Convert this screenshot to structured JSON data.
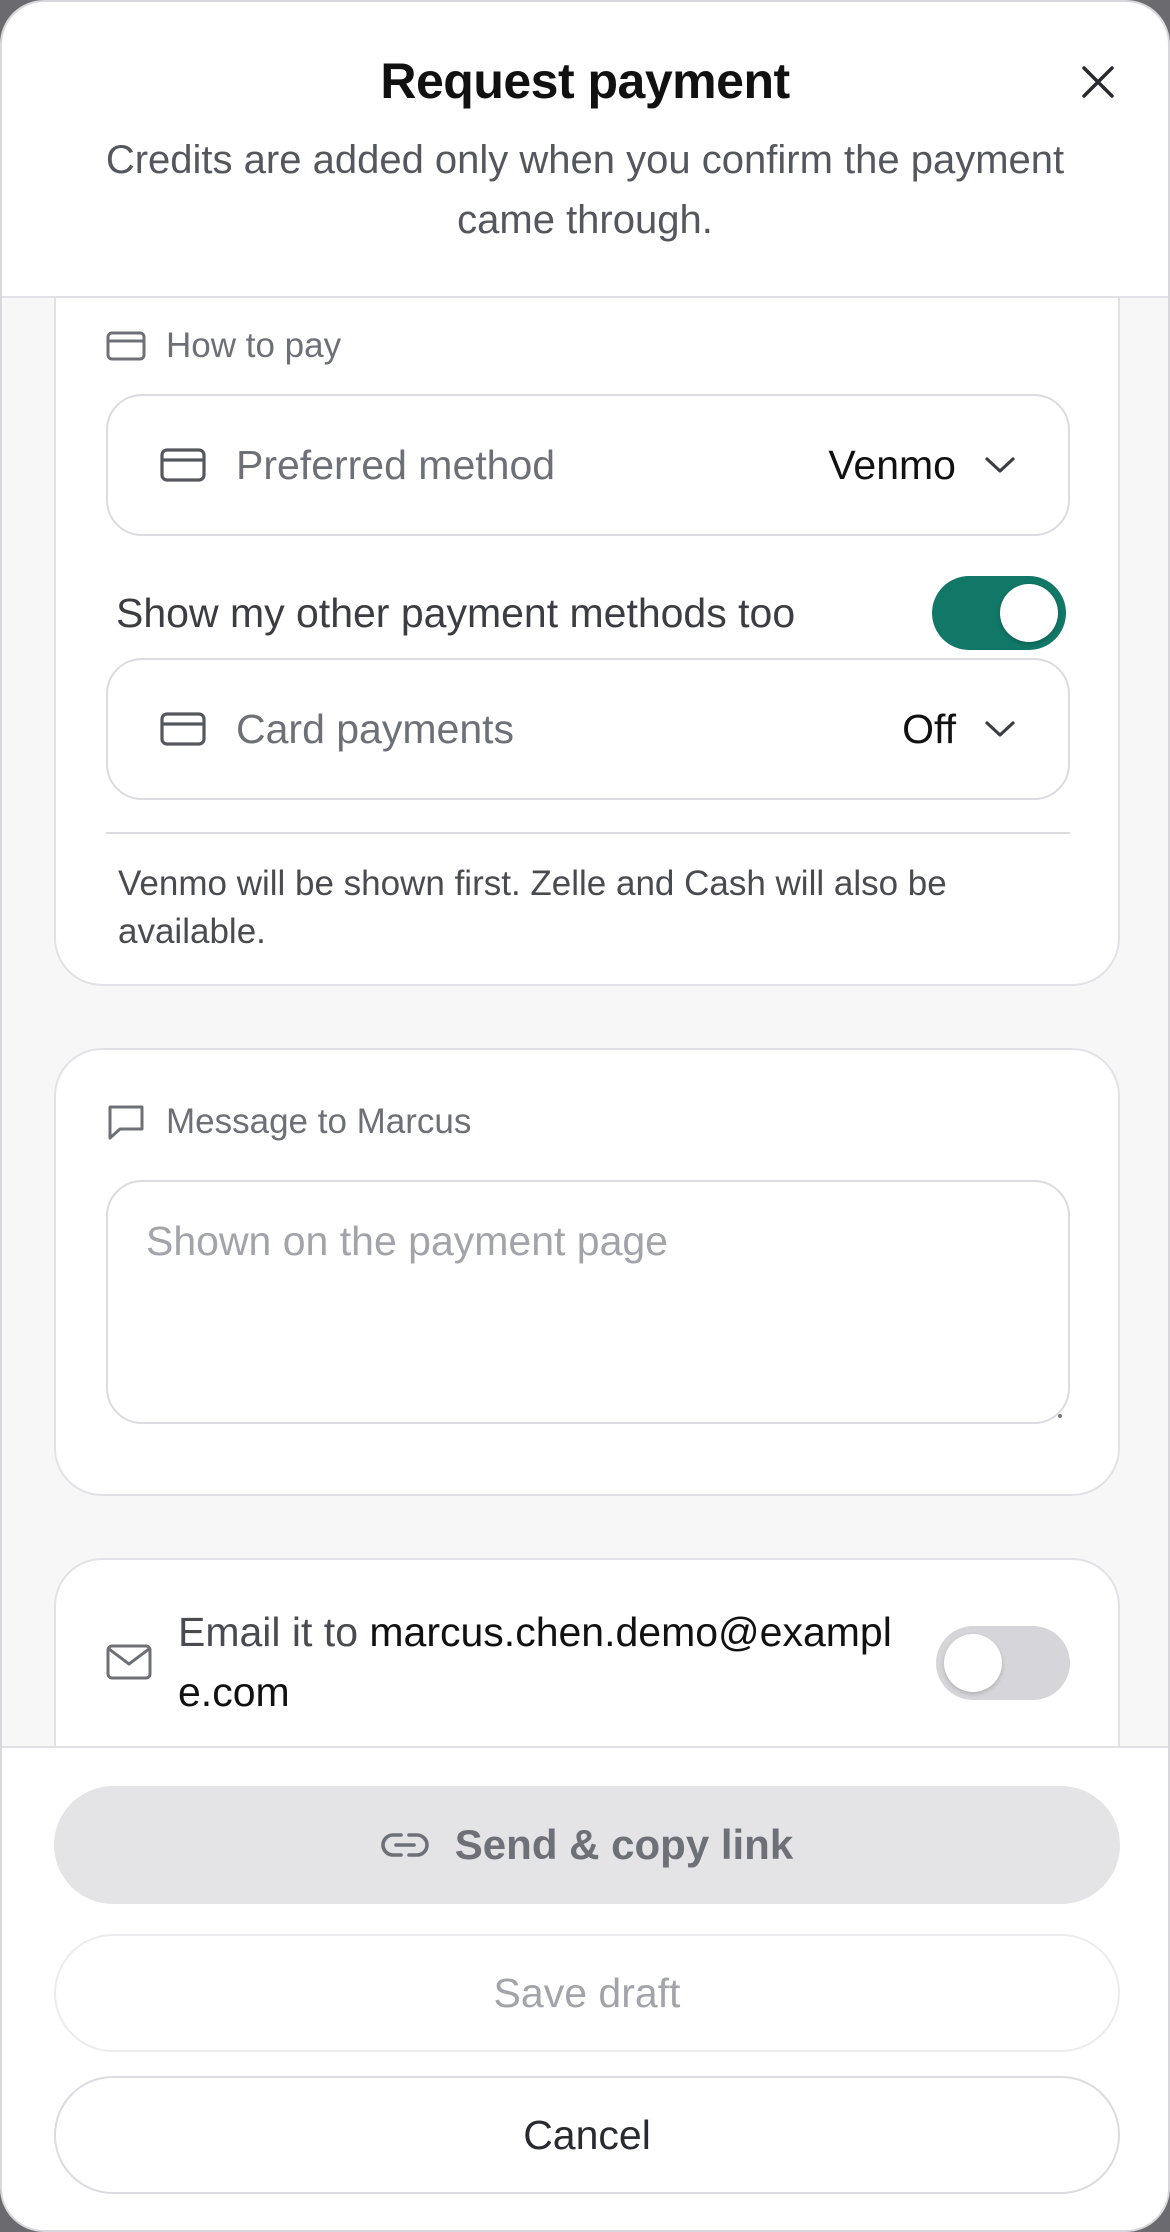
{
  "header": {
    "title": "Request payment",
    "subtitle": "Credits are added only when you confirm the payment came through."
  },
  "how_to_pay": {
    "label": "How to pay",
    "preferred_method": {
      "label": "Preferred method",
      "value": "Venmo"
    },
    "show_other": {
      "label": "Show my other payment methods too",
      "enabled": true
    },
    "card_payments": {
      "label": "Card payments",
      "value": "Off"
    },
    "note": "Venmo will be shown first. Zelle and Cash will also be available."
  },
  "message": {
    "label": "Message to Marcus",
    "placeholder": "Shown on the payment page"
  },
  "email": {
    "prefix": "Email it to ",
    "address": "marcus.chen.demo@example.com",
    "enabled": false
  },
  "footer": {
    "send_label": "Send & copy link",
    "draft_label": "Save draft",
    "cancel_label": "Cancel"
  },
  "colors": {
    "accent": "#117767",
    "toggle_off": "#d6d6da",
    "primary_disabled_bg": "#e4e4e7"
  }
}
